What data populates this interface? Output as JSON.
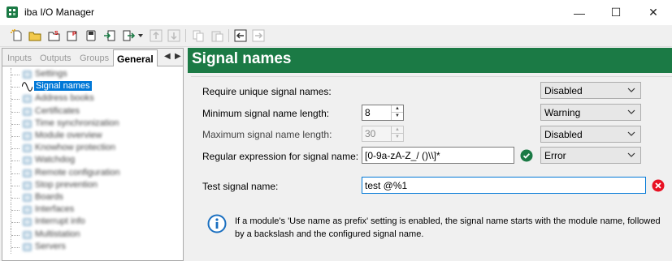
{
  "window": {
    "title": "iba I/O Manager",
    "controls": {
      "minimize": "—",
      "maximize": "☐",
      "close": "✕"
    }
  },
  "toolbar": {
    "buttons": [
      "new-icon",
      "open-icon",
      "save-icon",
      "save-all-icon",
      "save-copy-icon",
      "import-icon",
      "export-icon",
      "move-up-icon",
      "move-down-icon",
      "copy-icon",
      "paste-icon",
      "back-icon",
      "forward-icon"
    ]
  },
  "left": {
    "tabs": [
      "Inputs",
      "Outputs",
      "Groups",
      "General"
    ],
    "active_tab": "General",
    "tree": [
      {
        "label": "Settings",
        "blurred": true
      },
      {
        "label": "Signal names",
        "blurred": false,
        "selected": true
      },
      {
        "label": "Address books",
        "blurred": true
      },
      {
        "label": "Certificates",
        "blurred": true
      },
      {
        "label": "Time synchronization",
        "blurred": true
      },
      {
        "label": "Module overview",
        "blurred": true
      },
      {
        "label": "Knowhow protection",
        "blurred": true
      },
      {
        "label": "Watchdog",
        "blurred": true
      },
      {
        "label": "Remote configuration",
        "blurred": true
      },
      {
        "label": "Stop prevention",
        "blurred": true
      },
      {
        "label": "Boards",
        "blurred": true
      },
      {
        "label": "Interfaces",
        "blurred": true
      },
      {
        "label": "Interrupt info",
        "blurred": true
      },
      {
        "label": "Multistation",
        "blurred": true
      },
      {
        "label": "Servers",
        "blurred": true
      }
    ]
  },
  "main": {
    "title": "Signal names",
    "rows": {
      "unique": {
        "label": "Require unique signal names:",
        "severity": "Disabled"
      },
      "min_length": {
        "label": "Minimum signal name length:",
        "value": "8",
        "severity": "Warning"
      },
      "max_length": {
        "label": "Maximum signal name length:",
        "value": "30",
        "severity": "Disabled"
      },
      "regex": {
        "label": "Regular expression for signal name:",
        "value": "[0-9a-zA-Z_/ ()\\\\]*",
        "severity": "Error",
        "status": "valid"
      },
      "test": {
        "label": "Test signal name:",
        "value": "test @%1",
        "status": "invalid"
      }
    },
    "info": "If a module's 'Use name as prefix' setting is enabled, the signal name starts with the module name, followed by a backslash and the configured signal name."
  },
  "colors": {
    "header": "#1b7a45",
    "selection": "#0078d7",
    "valid": "#1b7a45",
    "invalid": "#e81123",
    "info": "#1a6fc0"
  }
}
